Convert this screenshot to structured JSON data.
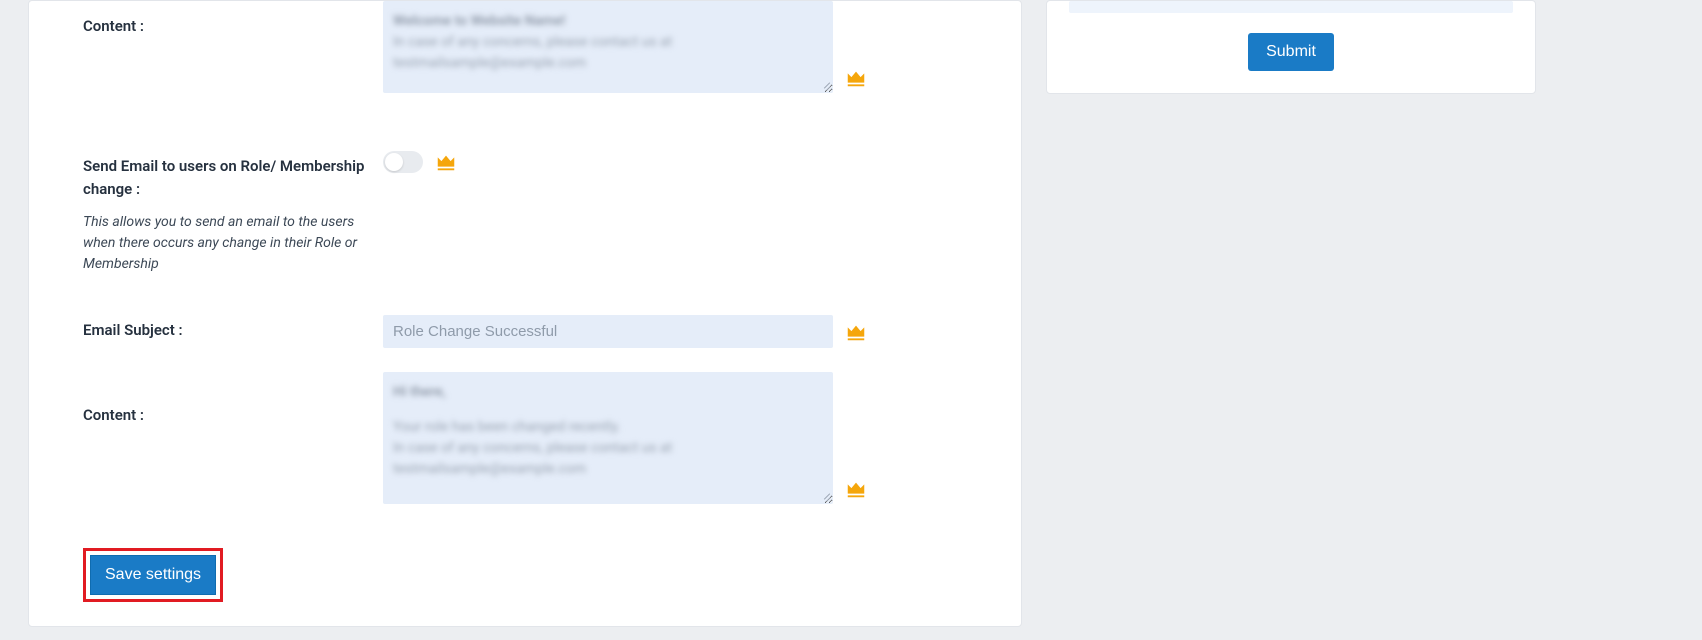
{
  "sidebar": {
    "submit_label": "Submit"
  },
  "section1": {
    "content_label": "Content :",
    "content_blur_line1": "Welcome to Website Name!",
    "content_blur_line2": "In case of any concerns, please contact us at",
    "content_blur_line3": "testmailsample@example.com"
  },
  "section2": {
    "toggle_label": "Send Email to users on Role/ Membership change :",
    "toggle_desc": "This allows you to send an email to the users when there occurs any change in their Role or Membership",
    "subject_label": "Email Subject :",
    "subject_value": "Role Change Successful",
    "content_label": "Content :",
    "content_blur_heading": "Hi there,",
    "content_blur_line1": "Your role has been changed recently.",
    "content_blur_line2": "In case of any concerns, please contact us at",
    "content_blur_line3": "testmailsample@example.com"
  },
  "actions": {
    "save_label": "Save settings"
  }
}
